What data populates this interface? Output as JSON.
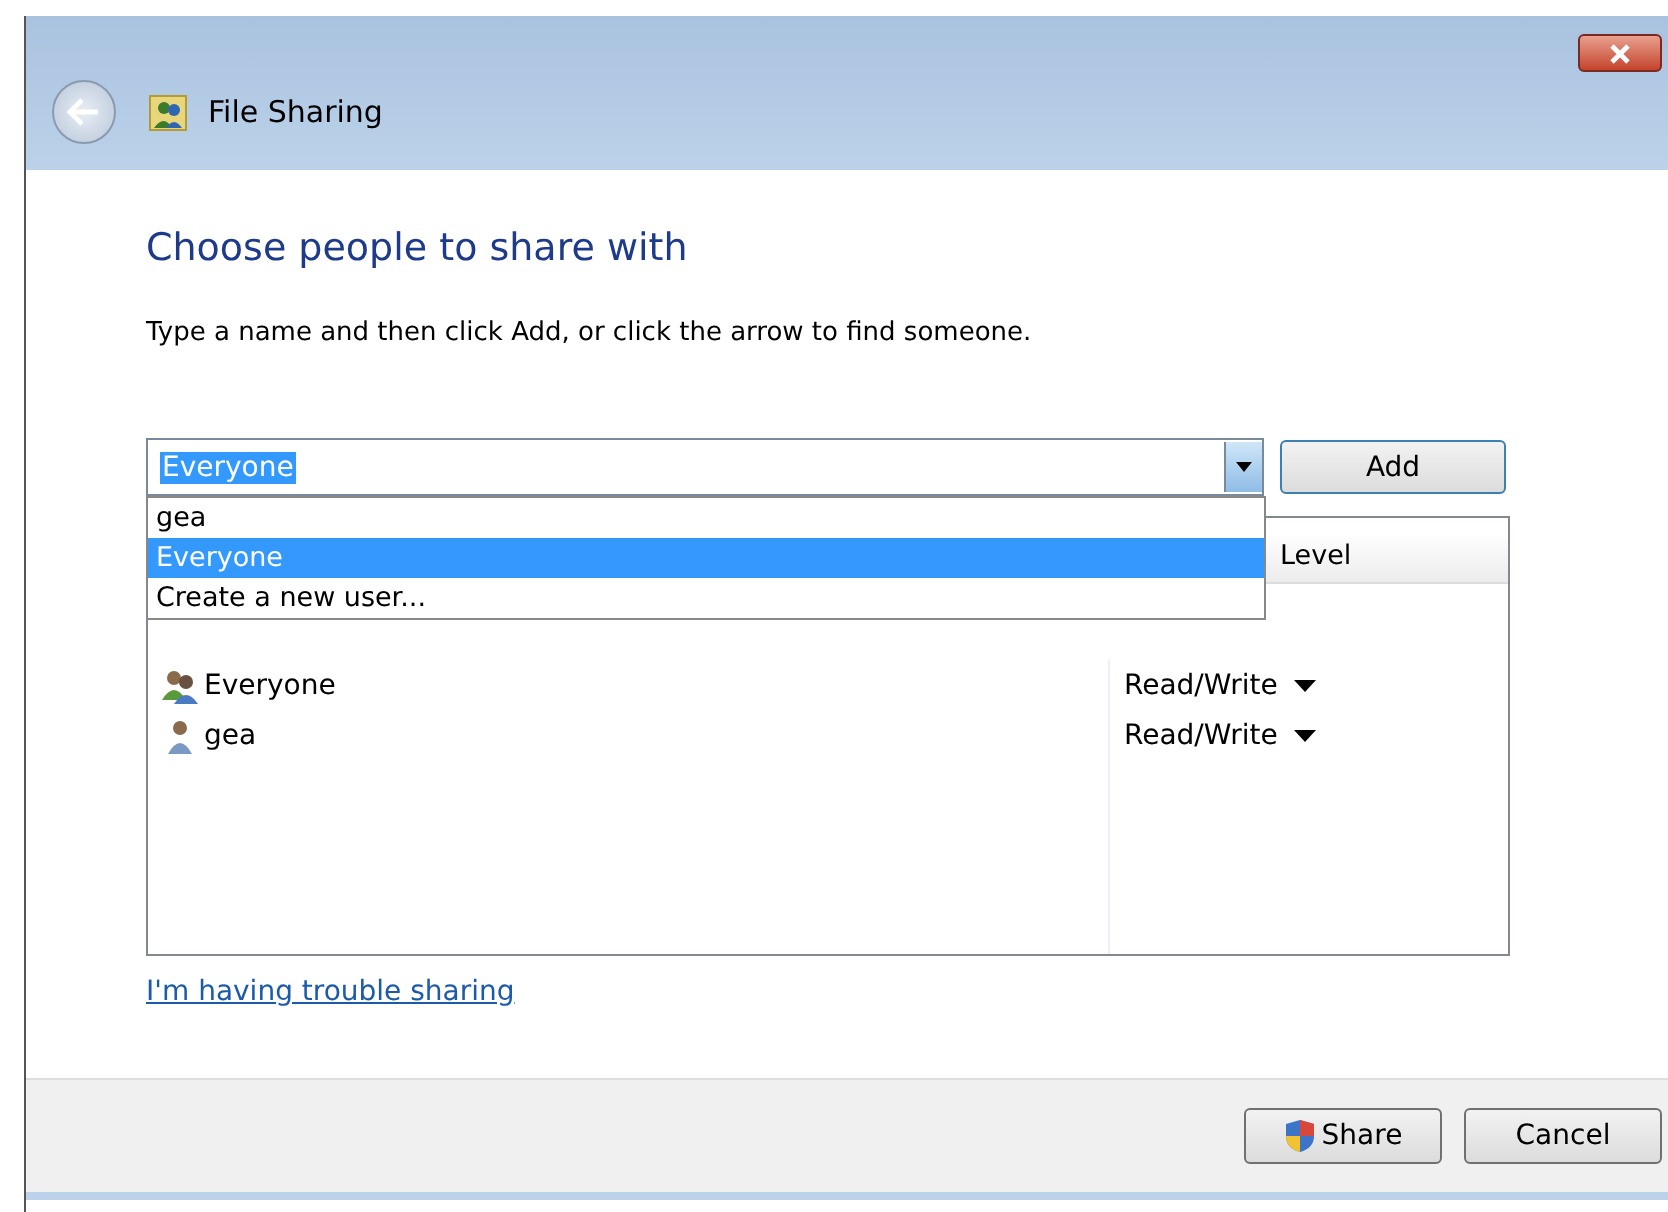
{
  "window": {
    "title": "File Sharing"
  },
  "heading": "Choose people to share with",
  "instruction": "Type a name and then click Add, or click the arrow to find someone.",
  "name_combo": {
    "value": "Everyone",
    "expanded": true,
    "options": [
      {
        "label": "gea",
        "selected": false
      },
      {
        "label": "Everyone",
        "selected": true
      },
      {
        "label": "Create a new user...",
        "selected": false
      }
    ]
  },
  "add_button": "Add",
  "table": {
    "column_2": "Level",
    "rows": [
      {
        "kind": "group",
        "name": "Everyone",
        "permission": "Read/Write"
      },
      {
        "kind": "user",
        "name": "gea",
        "permission": "Read/Write"
      }
    ]
  },
  "help_link": "I'm having trouble sharing",
  "buttons": [
    {
      "kind": "shield",
      "label": "Share"
    },
    {
      "kind": "plain",
      "label": "Cancel"
    }
  ]
}
